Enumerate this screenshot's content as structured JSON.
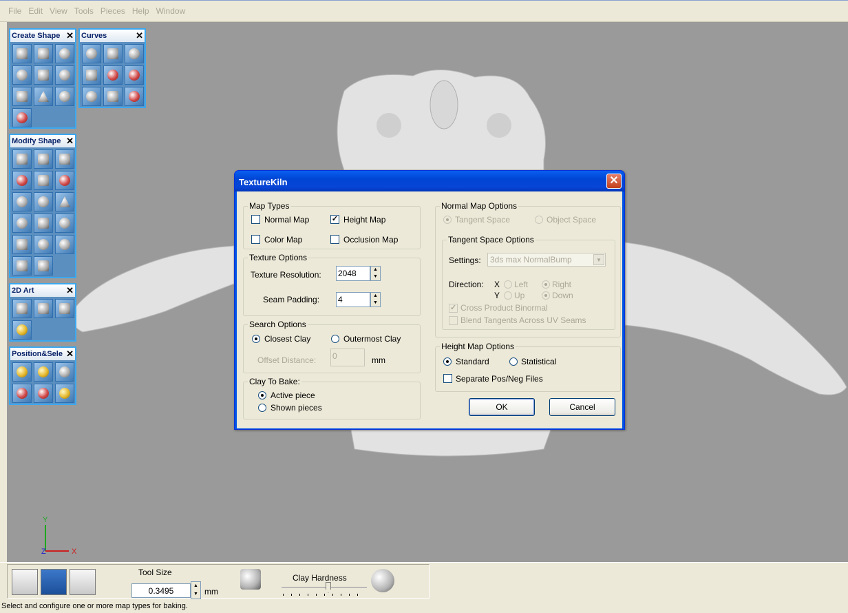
{
  "menu": [
    "File",
    "Edit",
    "View",
    "Tools",
    "Pieces",
    "Help",
    "Window"
  ],
  "palettes": {
    "create_shape": {
      "title": "Create Shape",
      "close": "✕"
    },
    "curves": {
      "title": "Curves",
      "close": "✕"
    },
    "modify_shape": {
      "title": "Modify Shape",
      "close": "✕"
    },
    "art2d": {
      "title": "2D Art",
      "close": "✕"
    },
    "position_select": {
      "title": "Position&Sele",
      "close": "✕"
    }
  },
  "axis": {
    "y": "Y",
    "z": "Z",
    "x": "X"
  },
  "dialog": {
    "title": "TextureKiln",
    "close": "✕",
    "map_types": {
      "legend": "Map Types",
      "normal_map": {
        "label": "Normal Map",
        "checked": false
      },
      "height_map": {
        "label": "Height Map",
        "checked": true
      },
      "color_map": {
        "label": "Color Map",
        "checked": false
      },
      "occlusion_map": {
        "label": "Occlusion Map",
        "checked": false
      }
    },
    "texture_options": {
      "legend": "Texture Options",
      "resolution_label": "Texture Resolution:",
      "resolution_value": "2048",
      "seam_label": "Seam Padding:",
      "seam_value": "4"
    },
    "search_options": {
      "legend": "Search Options",
      "closest": "Closest Clay",
      "outermost": "Outermost Clay",
      "offset_label": "Offset Distance:",
      "offset_value": "0",
      "offset_unit": "mm"
    },
    "clay_to_bake": {
      "legend": "Clay To Bake:",
      "active": "Active piece",
      "shown": "Shown pieces"
    },
    "normal_map_options": {
      "legend": "Normal Map Options",
      "tangent_space": "Tangent Space",
      "object_space": "Object Space"
    },
    "tangent_space_options": {
      "legend": "Tangent Space Options",
      "settings_label": "Settings:",
      "settings_value": "3ds max NormalBump",
      "direction_label": "Direction:",
      "x_label": "X",
      "y_label": "Y",
      "left": "Left",
      "right": "Right",
      "up": "Up",
      "down": "Down",
      "cross_product": "Cross Product Binormal",
      "blend_tangents": "Blend Tangents Across UV Seams"
    },
    "height_map_options": {
      "legend": "Height Map Options",
      "standard": "Standard",
      "statistical": "Statistical",
      "separate": "Separate Pos/Neg Files"
    },
    "ok": "OK",
    "cancel": "Cancel"
  },
  "bottom": {
    "tool_size_label": "Tool Size",
    "tool_size_value": "0.3495",
    "tool_size_unit": "mm",
    "clay_hardness_label": "Clay Hardness",
    "clay_hardness_level": 0.55
  },
  "status": "Select and configure one or more map types for baking."
}
